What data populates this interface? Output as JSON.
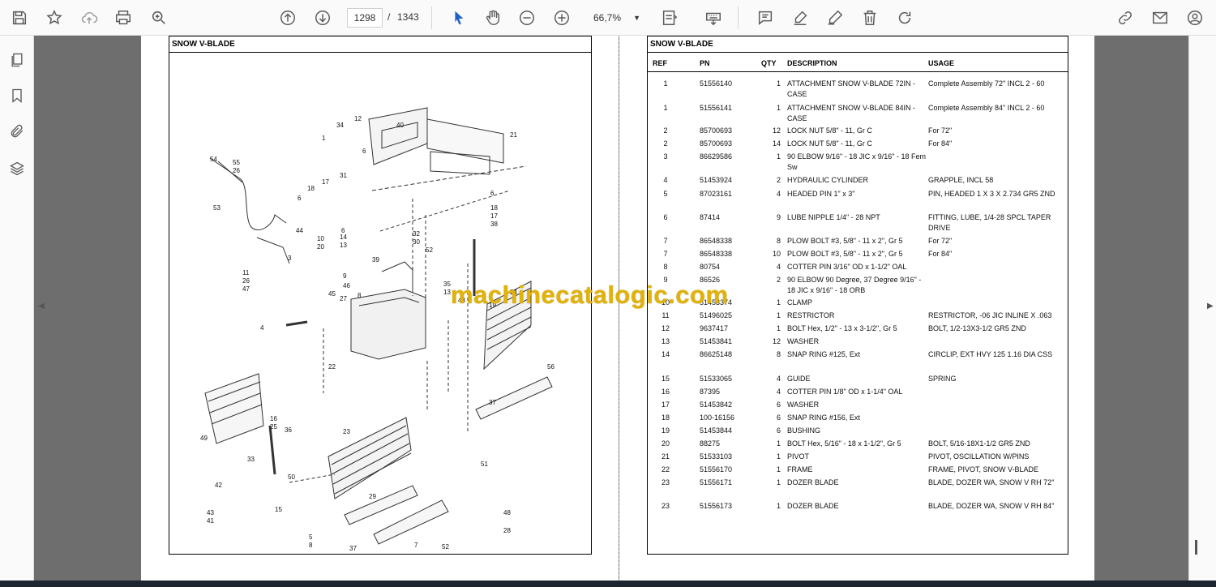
{
  "toolbar": {
    "page_current": "1298",
    "page_separator": "/",
    "page_total": "1343",
    "zoom": "66,7%"
  },
  "icons": [
    "save-icon",
    "bookmark-star-icon",
    "upload-cloud-icon",
    "print-icon",
    "zoom-search-icon",
    "arrow-up-circle-icon",
    "arrow-down-circle-icon",
    "cursor-icon",
    "hand-icon",
    "zoom-out-icon",
    "zoom-in-icon",
    "fit-page-icon",
    "keyboard-icon",
    "comment-icon",
    "highlight-pen-icon",
    "draw-icon",
    "trash-icon",
    "redo-icon",
    "link-sign-icon",
    "mail-icon",
    "account-icon"
  ],
  "left_page": {
    "title": "SNOW V-BLADE",
    "callouts": [
      "12",
      "34",
      "40",
      "1",
      "6",
      "21",
      "54",
      "55",
      "26",
      "31",
      "17",
      "18",
      "6",
      "53",
      "44",
      "6",
      "14",
      "13",
      "32",
      "30",
      "52",
      "10",
      "20",
      "3",
      "39",
      "11",
      "26",
      "47",
      "9",
      "46",
      "45",
      "27",
      "8",
      "35",
      "13",
      "43",
      "19",
      "24",
      "4",
      "22",
      "56",
      "37",
      "16",
      "25",
      "36",
      "23",
      "49",
      "33",
      "50",
      "15",
      "51",
      "42",
      "43",
      "41",
      "29",
      "48",
      "5",
      "8",
      "28",
      "37",
      "7",
      "52",
      "6",
      "18",
      "17",
      "38"
    ]
  },
  "right_page": {
    "title": "SNOW V-BLADE",
    "headers": {
      "ref": "REF",
      "pn": "PN",
      "qty": "QTY",
      "description": "DESCRIPTION",
      "usage": "USAGE"
    },
    "rows": [
      {
        "ref": "1",
        "pn": "51556140",
        "qty": "1",
        "description": "ATTACHMENT SNOW V-BLADE 72IN - CASE",
        "usage": "Complete Assembly 72\" INCL 2 - 60"
      },
      {
        "ref": "1",
        "pn": "51556141",
        "qty": "1",
        "description": "ATTACHMENT SNOW V-BLADE 84IN - CASE",
        "usage": "Complete Assembly 84\" INCL 2 - 60"
      },
      {
        "ref": "2",
        "pn": "85700693",
        "qty": "12",
        "description": "LOCK NUT 5/8\" - 11, Gr C",
        "usage": "For 72\""
      },
      {
        "ref": "2",
        "pn": "85700693",
        "qty": "14",
        "description": "LOCK NUT 5/8\" - 11, Gr C",
        "usage": "For 84\""
      },
      {
        "ref": "3",
        "pn": "86629586",
        "qty": "1",
        "description": "90 ELBOW 9/16\" - 18 JIC x 9/16\" - 18 Fem Sw",
        "usage": ""
      },
      {
        "ref": "4",
        "pn": "51453924",
        "qty": "2",
        "description": "HYDRAULIC CYLINDER",
        "usage": "GRAPPLE, INCL 58"
      },
      {
        "ref": "5",
        "pn": "87023161",
        "qty": "4",
        "description": "HEADED PIN 1\" x 3\"",
        "usage": "PIN, HEADED 1 X 3 X 2.734 GR5 ZND"
      },
      {
        "ref": "6",
        "pn": "87414",
        "qty": "9",
        "description": "LUBE NIPPLE 1/4\" - 28 NPT",
        "usage": "FITTING, LUBE, 1/4-28 SPCL TAPER DRIVE"
      },
      {
        "ref": "7",
        "pn": "86548338",
        "qty": "8",
        "description": "PLOW BOLT #3, 5/8\" - 11 x 2\", Gr 5",
        "usage": "For 72\""
      },
      {
        "ref": "7",
        "pn": "86548338",
        "qty": "10",
        "description": "PLOW BOLT #3, 5/8\" - 11 x 2\", Gr 5",
        "usage": "For 84\""
      },
      {
        "ref": "8",
        "pn": "80754",
        "qty": "4",
        "description": "COTTER PIN 3/16\" OD x 1-1/2\" OAL",
        "usage": ""
      },
      {
        "ref": "9",
        "pn": "86526",
        "qty": "2",
        "description": "90 ELBOW 90 Degree, 37 Degree 9/16\" - 18 JIC x 9/16\" - 18 ORB",
        "usage": ""
      },
      {
        "ref": "10",
        "pn": "51453374",
        "qty": "1",
        "description": "CLAMP",
        "usage": ""
      },
      {
        "ref": "11",
        "pn": "51496025",
        "qty": "1",
        "description": "RESTRICTOR",
        "usage": "RESTRICTOR, -06 JIC INLINE X .063"
      },
      {
        "ref": "12",
        "pn": "9637417",
        "qty": "1",
        "description": "BOLT Hex, 1/2\" - 13 x 3-1/2\", Gr 5",
        "usage": "BOLT, 1/2-13X3-1/2 GR5 ZND"
      },
      {
        "ref": "13",
        "pn": "51453841",
        "qty": "12",
        "description": "WASHER",
        "usage": ""
      },
      {
        "ref": "14",
        "pn": "86625148",
        "qty": "8",
        "description": "SNAP RING #125, Ext",
        "usage": "CIRCLIP, EXT HVY 125 1.16 DIA CSS"
      },
      {
        "ref": "15",
        "pn": "51533065",
        "qty": "4",
        "description": "GUIDE",
        "usage": "SPRING"
      },
      {
        "ref": "16",
        "pn": "87395",
        "qty": "4",
        "description": "COTTER PIN 1/8\" OD x 1-1/4\" OAL",
        "usage": ""
      },
      {
        "ref": "17",
        "pn": "51453842",
        "qty": "6",
        "description": "WASHER",
        "usage": ""
      },
      {
        "ref": "18",
        "pn": "100-16156",
        "qty": "6",
        "description": "SNAP RING #156, Ext",
        "usage": ""
      },
      {
        "ref": "19",
        "pn": "51453844",
        "qty": "6",
        "description": "BUSHING",
        "usage": ""
      },
      {
        "ref": "20",
        "pn": "88275",
        "qty": "1",
        "description": "BOLT Hex, 5/16\" - 18 x 1-1/2\", Gr 5",
        "usage": "BOLT, 5/16-18X1-1/2 GR5 ZND"
      },
      {
        "ref": "21",
        "pn": "51533103",
        "qty": "1",
        "description": "PIVOT",
        "usage": "PIVOT, OSCILLATION W/PINS"
      },
      {
        "ref": "22",
        "pn": "51556170",
        "qty": "1",
        "description": "FRAME",
        "usage": "FRAME, PIVOT, SNOW V-BLADE"
      },
      {
        "ref": "23",
        "pn": "51556171",
        "qty": "1",
        "description": "DOZER BLADE",
        "usage": "BLADE, DOZER WA, SNOW V RH 72\""
      },
      {
        "ref": "23",
        "pn": "51556173",
        "qty": "1",
        "description": "DOZER BLADE",
        "usage": "BLADE, DOZER WA, SNOW V RH 84\""
      }
    ]
  },
  "watermark": "machinecatalogic.com",
  "colors": {
    "toolbar_bg": "#fafafa",
    "canvas_bg": "#6e6e6e",
    "watermark": "#e1b20a",
    "cursor_active": "#1f5fc9"
  }
}
